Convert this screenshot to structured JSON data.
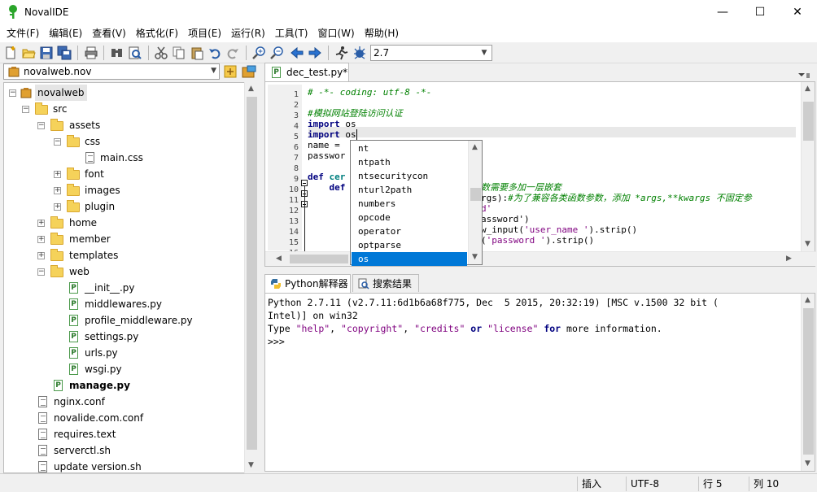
{
  "window": {
    "title": "NovalIDE",
    "minimize": "—",
    "maximize": "☐",
    "close": "✕"
  },
  "menu": [
    "文件(F)",
    "编辑(E)",
    "查看(V)",
    "格式化(F)",
    "项目(E)",
    "运行(R)",
    "工具(T)",
    "窗口(W)",
    "帮助(H)"
  ],
  "toolbar": {
    "python_version": "2.7"
  },
  "project": {
    "selected": "novalweb.nov"
  },
  "tree": [
    {
      "label": "novalweb",
      "type": "project",
      "expanded": true
    },
    {
      "label": "src",
      "type": "folder",
      "expanded": true
    },
    {
      "label": "assets",
      "type": "folder",
      "expanded": true
    },
    {
      "label": "css",
      "type": "folder",
      "expanded": true
    },
    {
      "label": "main.css",
      "type": "file"
    },
    {
      "label": "font",
      "type": "folder",
      "expanded": false
    },
    {
      "label": "images",
      "type": "folder",
      "expanded": false
    },
    {
      "label": "plugin",
      "type": "folder",
      "expanded": false
    },
    {
      "label": "home",
      "type": "folder",
      "expanded": false
    },
    {
      "label": "member",
      "type": "folder",
      "expanded": false
    },
    {
      "label": "templates",
      "type": "folder",
      "expanded": false
    },
    {
      "label": "web",
      "type": "folder",
      "expanded": true
    },
    {
      "label": "__init__.py",
      "type": "py"
    },
    {
      "label": "middlewares.py",
      "type": "py"
    },
    {
      "label": "profile_middleware.py",
      "type": "py"
    },
    {
      "label": "settings.py",
      "type": "py"
    },
    {
      "label": "urls.py",
      "type": "py"
    },
    {
      "label": "wsgi.py",
      "type": "py"
    },
    {
      "label": "manage.py",
      "type": "py",
      "bold": true
    },
    {
      "label": "nginx.conf",
      "type": "file"
    },
    {
      "label": "novalide.com.conf",
      "type": "file"
    },
    {
      "label": "requires.text",
      "type": "file"
    },
    {
      "label": "serverctl.sh",
      "type": "file"
    },
    {
      "label": "update version.sh",
      "type": "file"
    }
  ],
  "editor": {
    "tab_label": "dec_test.py*",
    "line_numbers": [
      "1",
      "2",
      "3",
      "4",
      "5",
      "6",
      "7",
      "8",
      "9",
      "10",
      "11",
      "12",
      "13",
      "14",
      "15",
      "16"
    ],
    "code": {
      "l1": "# -*- coding: utf-8 -*-",
      "l3": "#模拟网站登陆访问认证",
      "l4_kw": "import",
      "l4_rest": " os",
      "l5_kw": "import",
      "l5_rest": " os",
      "l6": "name = ",
      "l7": "passwor",
      "l9_kw": "def",
      "l9_name": " cer",
      "l10_indent": "    ",
      "l10_kw": "def",
      "l10_tail": "数需要多加一层嵌套",
      "l11_a": "rgs):",
      "l11_b": "#为了兼容各类函数参数，添加 *args,**kwargs 不固定参",
      "l12_tail": "d'",
      "l13_tail": "assword')",
      "l14_a": "w_input(",
      "l14_b": "'user_name '",
      "l14_c": ").strip()",
      "l15_a": "(",
      "l15_b": "'password '",
      "l15_c": ").strip()"
    }
  },
  "autocomplete": {
    "items": [
      "nt",
      "ntpath",
      "ntsecuritycon",
      "nturl2path",
      "numbers",
      "opcode",
      "operator",
      "optparse",
      "os"
    ],
    "selected_index": 8
  },
  "bottom_tabs": [
    "Python解释器",
    "搜索结果"
  ],
  "shell": {
    "line1": "Python 2.7.11 (v2.7.11:6d1b6a68f775, Dec  5 2015, 20:32:19) [MSC v.1500 32 bit (",
    "line2": "Intel)] on win32",
    "line3_a": "Type ",
    "line3_s1": "\"help\"",
    "line3_c1": ", ",
    "line3_s2": "\"copyright\"",
    "line3_c2": ", ",
    "line3_s3": "\"credits\"",
    "line3_k1": " or ",
    "line3_s4": "\"license\"",
    "line3_k2": " for",
    "line3_end": " more information.",
    "prompt": ">>>"
  },
  "status": {
    "mode": "插入",
    "encoding": "UTF-8",
    "line": "行 5",
    "col": "列 10"
  },
  "colors": {
    "accent": "#0078d7",
    "comment": "#008000",
    "keyword": "#00007f",
    "string": "#7f007f",
    "folder": "#f5d25a"
  }
}
